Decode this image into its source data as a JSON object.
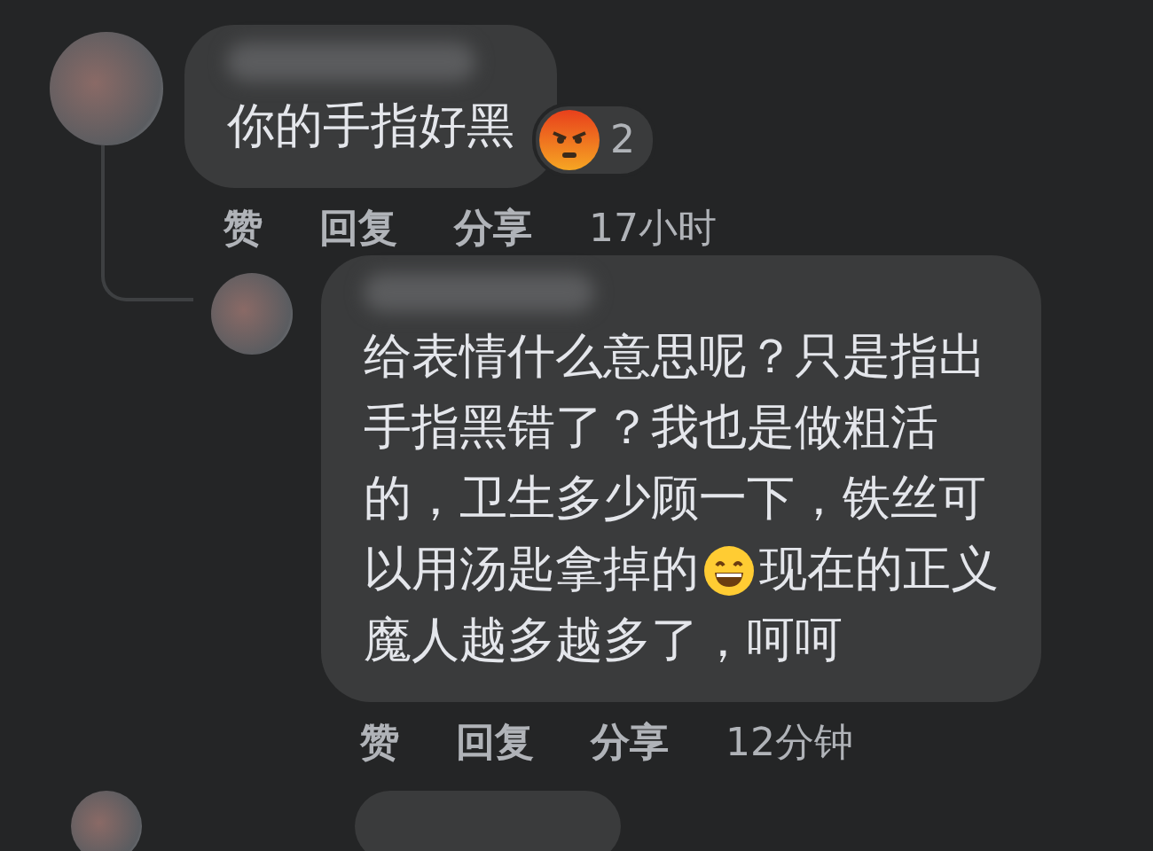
{
  "comments": [
    {
      "lines": [
        [
          {
            "kind": "text",
            "text": "你的手指好黑"
          }
        ]
      ],
      "reaction": {
        "kind": "angry",
        "count": "2"
      },
      "actions": [
        "赞",
        "回复",
        "分享"
      ],
      "time": "17小时",
      "replies": [
        {
          "lines": [
            [
              {
                "kind": "text",
                "text": "给表情什么意思呢？只是指出"
              }
            ],
            [
              {
                "kind": "text",
                "text": "手指黑错了？我也是做粗活"
              }
            ],
            [
              {
                "kind": "text",
                "text": "的，卫生多少顾一下，铁丝可"
              }
            ],
            [
              {
                "kind": "text",
                "text": "以用汤匙拿掉的"
              },
              {
                "kind": "grin"
              },
              {
                "kind": "text",
                "text": "现在的正义"
              }
            ],
            [
              {
                "kind": "text",
                "text": "魔人越多越多了，呵呵"
              }
            ]
          ],
          "actions": [
            "赞",
            "回复",
            "分享"
          ],
          "time": "12分钟"
        }
      ]
    }
  ]
}
